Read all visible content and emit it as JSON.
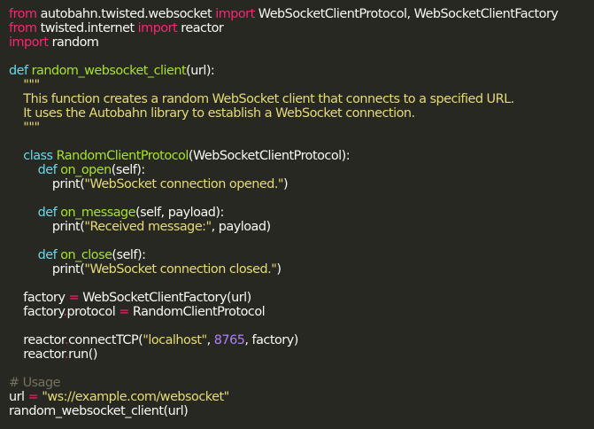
{
  "theme": {
    "background": "#272822",
    "text": "#f8f8f2",
    "keyword": "#f92672",
    "definition": "#66d9ef",
    "function_name": "#a6e22e",
    "string": "#e6db74",
    "number": "#ae81ff",
    "comment": "#75715e"
  },
  "code": {
    "lines": [
      [
        [
          "kw",
          "from"
        ],
        [
          "txt",
          " autobahn.twisted.websocket "
        ],
        [
          "kw",
          "import"
        ],
        [
          "txt",
          " WebSocketClientProtocol, WebSocketClientFactory"
        ]
      ],
      [
        [
          "kw",
          "from"
        ],
        [
          "txt",
          " twisted.internet "
        ],
        [
          "kw",
          "import"
        ],
        [
          "txt",
          " reactor"
        ]
      ],
      [
        [
          "kw",
          "import"
        ],
        [
          "txt",
          " random"
        ]
      ],
      [],
      [
        [
          "def",
          "def"
        ],
        [
          "txt",
          " "
        ],
        [
          "fn",
          "random_websocket_client"
        ],
        [
          "txt",
          "(url):"
        ]
      ],
      [
        [
          "str",
          "    \"\"\""
        ]
      ],
      [
        [
          "str",
          "    This function creates a random WebSocket client that connects to a specified URL."
        ]
      ],
      [
        [
          "str",
          "    It uses the Autobahn library to establish a WebSocket connection."
        ]
      ],
      [
        [
          "str",
          "    \"\"\""
        ]
      ],
      [],
      [
        [
          "def",
          "    class"
        ],
        [
          "txt",
          " "
        ],
        [
          "fn",
          "RandomClientProtocol"
        ],
        [
          "txt",
          "(WebSocketClientProtocol):"
        ]
      ],
      [
        [
          "def",
          "        def"
        ],
        [
          "txt",
          " "
        ],
        [
          "fn",
          "on_open"
        ],
        [
          "txt",
          "(self):"
        ]
      ],
      [
        [
          "txt",
          "            print("
        ],
        [
          "str",
          "\"WebSocket connection opened.\""
        ],
        [
          "txt",
          ")"
        ]
      ],
      [],
      [
        [
          "def",
          "        def"
        ],
        [
          "txt",
          " "
        ],
        [
          "fn",
          "on_message"
        ],
        [
          "txt",
          "(self, payload):"
        ]
      ],
      [
        [
          "txt",
          "            print("
        ],
        [
          "str",
          "\"Received message:\""
        ],
        [
          "txt",
          ", payload)"
        ]
      ],
      [],
      [
        [
          "def",
          "        def"
        ],
        [
          "txt",
          " "
        ],
        [
          "fn",
          "on_close"
        ],
        [
          "txt",
          "(self):"
        ]
      ],
      [
        [
          "txt",
          "            print("
        ],
        [
          "str",
          "\"WebSocket connection closed.\""
        ],
        [
          "txt",
          ")"
        ]
      ],
      [],
      [
        [
          "txt",
          "    factory "
        ],
        [
          "op",
          "="
        ],
        [
          "txt",
          " WebSocketClientFactory(url)"
        ]
      ],
      [
        [
          "txt",
          "    factory"
        ],
        [
          "op",
          "."
        ],
        [
          "txt",
          "protocol "
        ],
        [
          "op",
          "="
        ],
        [
          "txt",
          " RandomClientProtocol"
        ]
      ],
      [],
      [
        [
          "txt",
          "    reactor"
        ],
        [
          "op",
          "."
        ],
        [
          "txt",
          "connectTCP("
        ],
        [
          "str",
          "\"localhost\""
        ],
        [
          "txt",
          ", "
        ],
        [
          "num",
          "8765"
        ],
        [
          "txt",
          ", factory)"
        ]
      ],
      [
        [
          "txt",
          "    reactor"
        ],
        [
          "op",
          "."
        ],
        [
          "txt",
          "run()"
        ]
      ],
      [],
      [
        [
          "com",
          "# Usage"
        ]
      ],
      [
        [
          "txt",
          "url "
        ],
        [
          "op",
          "="
        ],
        [
          "txt",
          " "
        ],
        [
          "str",
          "\"ws://example.com/websocket\""
        ]
      ],
      [
        [
          "txt",
          "random_websocket_client(url)"
        ]
      ]
    ]
  }
}
